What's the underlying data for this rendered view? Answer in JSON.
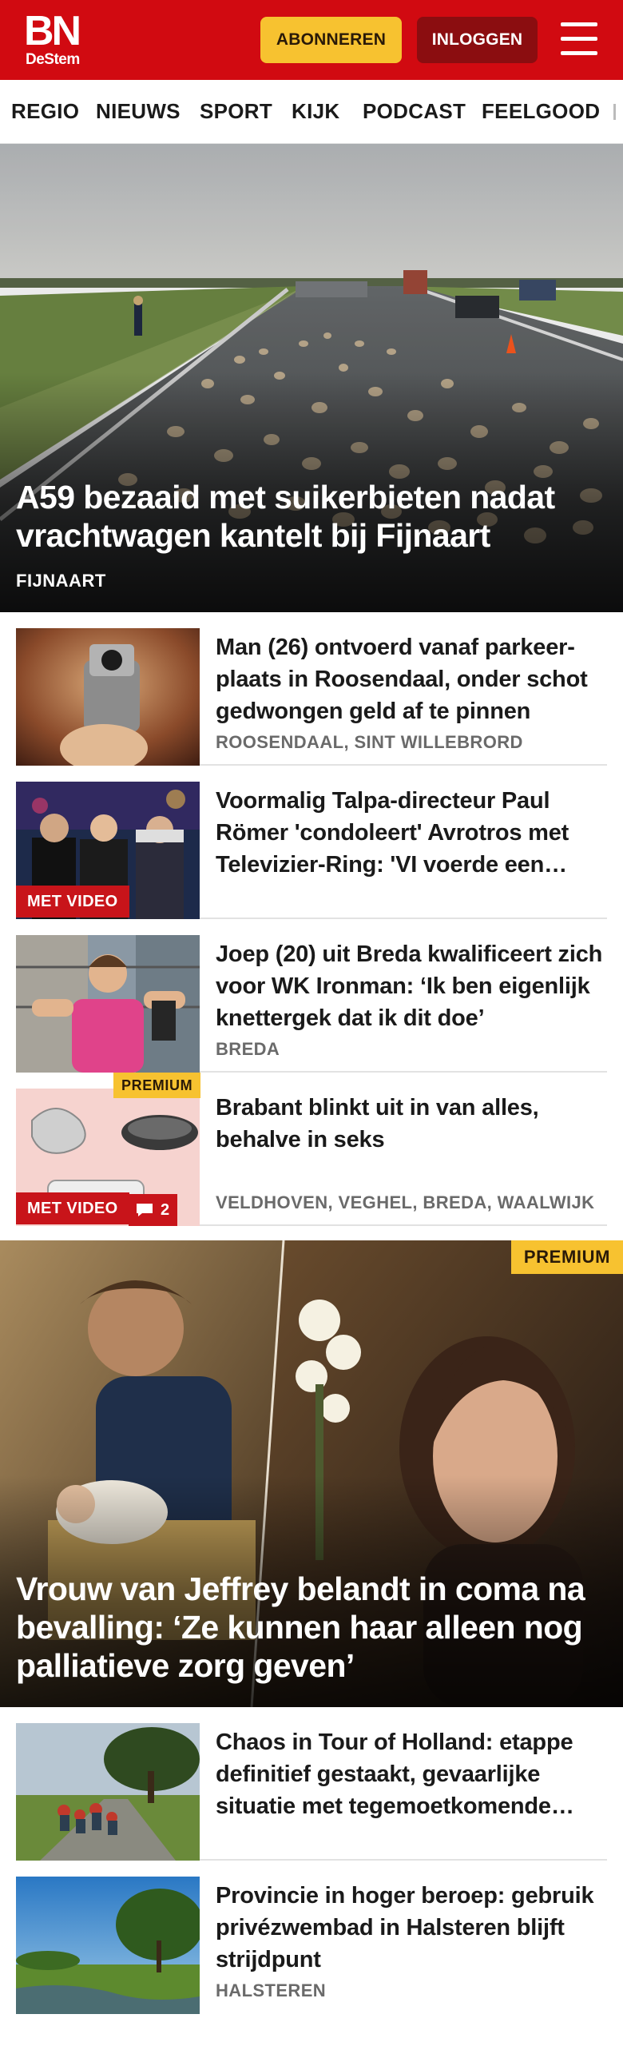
{
  "header": {
    "logo_main": "BN",
    "logo_sub": "DeStem",
    "subscribe_label": "ABONNEREN",
    "login_label": "INLOGGEN",
    "menu_icon": "hamburger-menu-icon",
    "brand_color": "#d10a11"
  },
  "nav": {
    "items": [
      "REGIO",
      "NIEUWS",
      "SPORT",
      "KIJK",
      "PODCAST",
      "FEELGOOD"
    ]
  },
  "hero": {
    "title": "A59 bezaaid met suikerbieten nadat vrachtwagen kantelt bij Fijnaart",
    "location": "FIJNAART"
  },
  "articles": [
    {
      "title": "Man (26) ontvoerd vanaf parkeer­plaats in Roosendaal, onder schot gedwongen geld af te pinnen",
      "location": "ROOSENDAAL, SINT WILLEBRORD"
    },
    {
      "title": "Voormalig Talpa-directeur Paul Römer 'condoleert' Avrotros met Televizier-Ring: 'VI voerde een oneerlijke strijd'",
      "badge_video": "MET VIDEO"
    },
    {
      "title": "Joep (20) uit Breda kwalificeert zich voor WK Ironman: ‘Ik ben eigenlijk knettergek dat ik dit doe’",
      "location": "BREDA"
    },
    {
      "title": "Brabant blinkt uit in van alles, behalve in seks",
      "location": "VELDHOVEN, VEGHEL, BREDA, WAALWIJK",
      "badge_premium": "PREMIUM",
      "badge_video": "MET VIDEO",
      "comments": "2"
    }
  ],
  "feature": {
    "title": "Vrouw van Jeffrey belandt in coma na bevalling: ‘Ze kunnen haar alleen nog palliatieve zorg geven’",
    "badge_premium": "PREMIUM"
  },
  "articles2": [
    {
      "title": "Chaos in Tour of Holland: etappe definitief gestaakt, gevaarlijke situatie met tegemoetkomende auto's"
    },
    {
      "title": "Provincie in hoger beroep: gebruik privézwembad in Halsteren blijft strijdpunt",
      "location": "HALSTEREN"
    }
  ],
  "colors": {
    "accent_red": "#d10a11",
    "premium_yellow": "#f7c230",
    "video_badge": "#c8141a"
  }
}
